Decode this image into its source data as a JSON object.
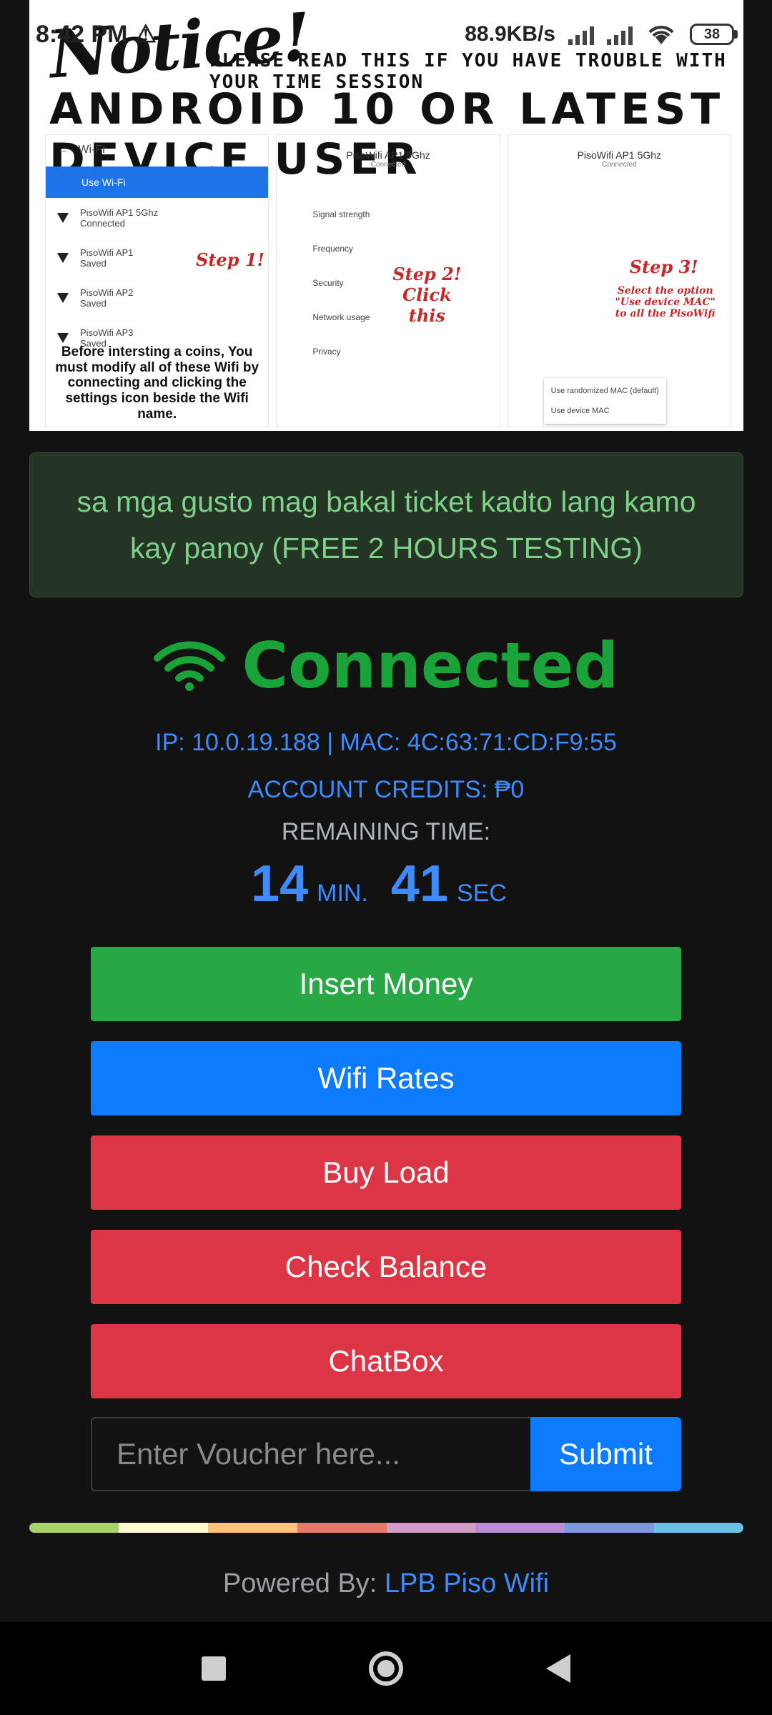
{
  "status_bar": {
    "time": "8:42 PM",
    "net_speed": "88.9KB/s",
    "battery": "38"
  },
  "banner": {
    "notice": "Notice!",
    "read_line": "PLEASE READ THIS IF YOU HAVE TROUBLE WITH YOUR TIME SESSION",
    "android_line": "ANDROID 10 OR LATEST DEVICE USER",
    "panel1": {
      "wifi_title": "Wi-Fi",
      "use_wifi": "Use Wi-Fi",
      "networks": [
        {
          "name": "PisoWifi AP1 5Ghz",
          "status": "Connected"
        },
        {
          "name": "PisoWifi AP1",
          "status": "Saved"
        },
        {
          "name": "PisoWifi AP2",
          "status": "Saved"
        },
        {
          "name": "PisoWifi AP3",
          "status": "Saved"
        }
      ],
      "step": "Step 1!",
      "caption": "Before intersting a coins, You must modify all of these Wifi by connecting and clicking the settings icon beside the Wifi name."
    },
    "panel2": {
      "network": "PisoWifi AP1 5Ghz",
      "status": "Connected",
      "step": "Step 2! Click this",
      "rows": [
        "Signal strength",
        "Frequency",
        "Security",
        "Network usage",
        "Privacy"
      ]
    },
    "panel3": {
      "network": "PisoWifi AP1 5Ghz",
      "status": "Connected",
      "step": "Step 3!",
      "instruction": "Select the option \"Use device MAC\" to all the PisoWifi",
      "options": [
        "Use randomized MAC (default)",
        "Use device MAC"
      ]
    }
  },
  "notice_text": "sa mga gusto mag bakal ticket kadto lang kamo kay panoy (FREE 2 HOURS TESTING)",
  "status": {
    "connected_label": "Connected",
    "ip_mac": "IP: 10.0.19.188 | MAC: 4C:63:71:CD:F9:55",
    "credits": "ACCOUNT CREDITS: ₱0",
    "remaining_label": "REMAINING TIME:",
    "minutes": "14",
    "min_unit": "MIN.",
    "seconds": "41",
    "sec_unit": "SEC"
  },
  "buttons": {
    "insert_money": "Insert Money",
    "wifi_rates": "Wifi Rates",
    "buy_load": "Buy Load",
    "check_balance": "Check Balance",
    "chatbox": "ChatBox"
  },
  "voucher": {
    "placeholder": "Enter Voucher here...",
    "submit": "Submit"
  },
  "footer": {
    "prefix": "Powered By:",
    "brand": "LPB Piso Wifi"
  },
  "colors": {
    "connected_green": "#1aa338",
    "accent_blue": "#3d8bfd",
    "button_green": "#28a745",
    "button_blue": "#0d7bfd",
    "button_red": "#dc3545",
    "rainbow": [
      "#a8d36b",
      "#fffbd1",
      "#ffc37a",
      "#e8786a",
      "#d39bc8",
      "#b98ed6",
      "#7c9ad9",
      "#6cc0e6"
    ]
  }
}
